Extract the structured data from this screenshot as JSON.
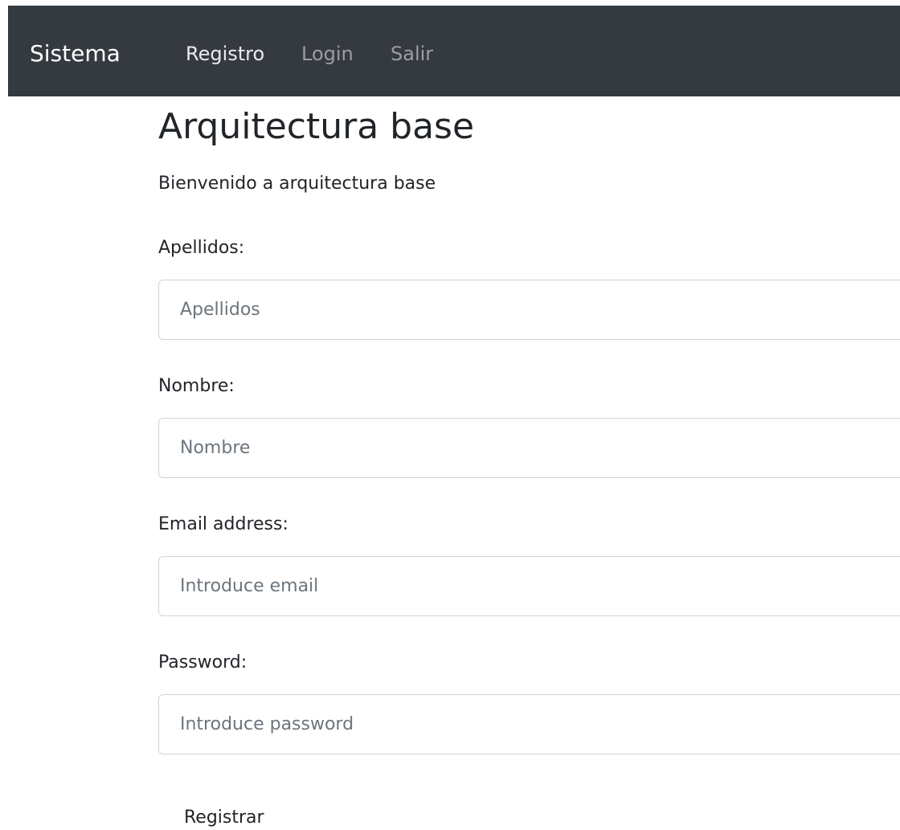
{
  "navbar": {
    "brand": "Sistema",
    "links": [
      {
        "label": "Registro"
      },
      {
        "label": "Login"
      },
      {
        "label": "Salir"
      }
    ]
  },
  "main": {
    "title": "Arquitectura base",
    "lead": "Bienvenido a arquitectura base",
    "form": {
      "fields": [
        {
          "label": "Apellidos:",
          "placeholder": "Apellidos"
        },
        {
          "label": "Nombre:",
          "placeholder": "Nombre"
        },
        {
          "label": "Email address:",
          "placeholder": "Introduce email"
        },
        {
          "label": "Password:",
          "placeholder": "Introduce password"
        }
      ],
      "submit_label": "Registrar"
    }
  },
  "colors": {
    "navbar_bg": "#343a40",
    "text": "#212529",
    "input_border": "#ced4da",
    "placeholder": "#6c757d"
  }
}
